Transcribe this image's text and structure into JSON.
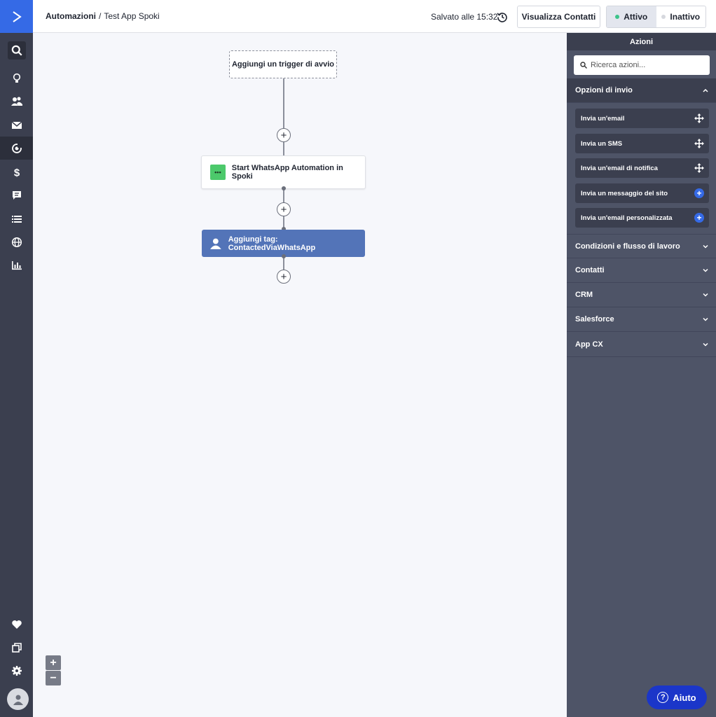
{
  "breadcrumb": {
    "section": "Automazioni",
    "separator": "/",
    "current": "Test App Spoki"
  },
  "header": {
    "saved_text": "Salvato alle 15:32",
    "contacts_button": "Visualizza Contatti",
    "toggle": {
      "active_label": "Attivo",
      "inactive_label": "Inattivo",
      "selected": "Attivo"
    },
    "active_dot_color": "#3cc48a",
    "inactive_dot_color": "#d6d8de"
  },
  "workflow": {
    "trigger_label": "Aggiungi un trigger di avvio",
    "step1_label": "Start WhatsApp Automation in Spoki",
    "step1_icon_text": "•••",
    "step2_label": "Aggiungi tag: ContactedViaWhatsApp",
    "plus_symbol": "+"
  },
  "zoom": {
    "in": "+",
    "out": "−"
  },
  "panel": {
    "title": "Azioni",
    "search_placeholder": "Ricerca azioni...",
    "sections": [
      {
        "label": "Opzioni di invio",
        "expanded": true
      },
      {
        "label": "Condizioni e flusso di lavoro",
        "expanded": false
      },
      {
        "label": "Contatti",
        "expanded": false
      },
      {
        "label": "CRM",
        "expanded": false
      },
      {
        "label": "Salesforce",
        "expanded": false
      },
      {
        "label": "App CX",
        "expanded": false
      }
    ],
    "items": [
      {
        "label": "Invia un'email",
        "icon": "move-icon"
      },
      {
        "label": "Invia un SMS",
        "icon": "move-icon"
      },
      {
        "label": "Invia un'email di notifica",
        "icon": "move-icon"
      },
      {
        "label": "Invia un messaggio del sito",
        "icon": "plus-icon"
      },
      {
        "label": "Invia un'email personalizzata",
        "icon": "plus-icon"
      }
    ],
    "plus_symbol": "+"
  },
  "help": {
    "label": "Aiuto",
    "icon_text": "?"
  },
  "colors": {
    "brand": "#356ae6",
    "nav_bg": "#3b3f4f",
    "panel_bg": "#4e5467",
    "tag_node": "#5374b8",
    "help_button": "#1b36c9"
  }
}
